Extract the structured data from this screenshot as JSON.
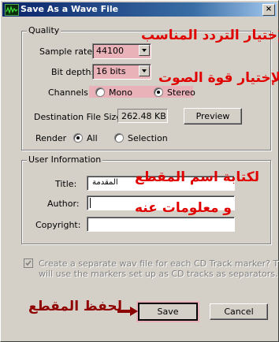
{
  "window": {
    "title": "Save As a Wave File",
    "close_glyph": "×",
    "icon": "wave-file-icon"
  },
  "quality": {
    "group_label": "Quality",
    "sample_rate_label": "Sample rate:",
    "sample_rate_value": "44100",
    "bit_depth_label": "Bit depth:",
    "bit_depth_value": "16 bits",
    "channels_label": "Channels:",
    "channel_mono": "Mono",
    "channel_stereo": "Stereo",
    "selected_channel": "Stereo",
    "dest_size_label": "Destination File Size :",
    "dest_size_value": "262.48 KB",
    "preview_label": "Preview",
    "render_label": "Render",
    "render_all": "All",
    "render_selection": "Selection",
    "selected_render": "All"
  },
  "user_info": {
    "group_label": "User Information",
    "title_label": "Title:",
    "title_value": "المقدمة",
    "author_label": "Author:",
    "author_value": "",
    "copyright_label": "Copyright:",
    "copyright_value": ""
  },
  "cd_marker": {
    "checked": true,
    "text_line1": "Create a separate wav file for each CD Track marker?  This",
    "text_line2": "will use the markers set up as CD tracks as separators."
  },
  "buttons": {
    "save_label": "Save",
    "cancel_label": "Cancel"
  },
  "annotations": {
    "sample_rate_note": "لإختيار التردد المناسب",
    "bit_depth_note": "لإختيار قوة الصوت",
    "title_note_line1": "لكتابة اسم المقطع",
    "title_note_line2": "و معلومات عنه",
    "save_note": "لحفظ المقطع",
    "arrow_color": "#8b0000",
    "text_color": "#e00000"
  }
}
